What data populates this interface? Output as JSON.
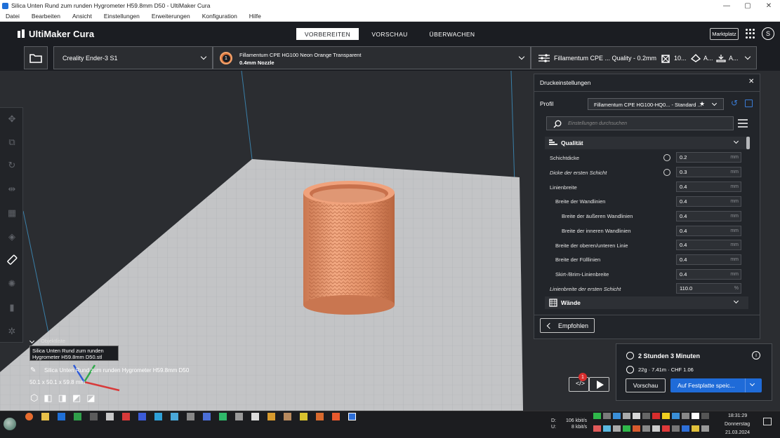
{
  "window": {
    "title": "Silica Unten Rund zum runden Hygrometer H59.8mm D50 - UltiMaker Cura"
  },
  "menu": [
    "Datei",
    "Bearbeiten",
    "Ansicht",
    "Einstellungen",
    "Erweiterungen",
    "Konfiguration",
    "Hilfe"
  ],
  "header": {
    "logo": "UltiMaker Cura",
    "tabs": [
      "VORBEREITEN",
      "VORSCHAU",
      "ÜBERWACHEN"
    ],
    "marketplace": "Marktplatz",
    "avatar_initial": "S"
  },
  "stagebar": {
    "printer": "Creality Ender-3 S1",
    "material_badge": "1",
    "material_name": "Fillamentum CPE HG100 Neon Orange Transparent",
    "nozzle": "0.4mm Nozzle",
    "profile_summary": "Fillamentum CPE ... Quality - 0.2mm",
    "infill": "10...",
    "support": "A...",
    "adhesion": "A..."
  },
  "object": {
    "list_label": "Objektliste",
    "tooltip_line1": "Silica Unten Rund zum runden",
    "tooltip_line2": "Hygrometer H59.8mm D50.stl",
    "name": "Silica Unten Rund zum runden Hygrometer H59.8mm D50",
    "dimensions": "50.1 x 50.1 x 59.8 mm"
  },
  "panel": {
    "title": "Druckeinstellungen",
    "profile_label": "Profil",
    "profile_value": "Fillamentum CPE HG100-HQ0... - Standard ...",
    "search_placeholder": "Einstellungen durchsuchen",
    "section_quality": "Qualität",
    "section_walls": "Wände",
    "rows": [
      {
        "label": "Schichtdicke",
        "value": "0.2",
        "unit": "mm"
      },
      {
        "label": "Dicke der ersten Schicht",
        "value": "0.3",
        "unit": "mm"
      },
      {
        "label": "Linienbreite",
        "value": "0.4",
        "unit": "mm"
      },
      {
        "label": "Breite der Wandlinien",
        "value": "0.4",
        "unit": "mm"
      },
      {
        "label": "Breite der äußeren Wandlinien",
        "value": "0.4",
        "unit": "mm"
      },
      {
        "label": "Breite der inneren Wandlinien",
        "value": "0.4",
        "unit": "mm"
      },
      {
        "label": "Breite der oberen/unteren Linie",
        "value": "0.4",
        "unit": "mm"
      },
      {
        "label": "Breite der Fülllinien",
        "value": "0.4",
        "unit": "mm"
      },
      {
        "label": "Skirt-/Brim-Linienbreite",
        "value": "0.4",
        "unit": "mm"
      },
      {
        "label": "Linienbreite der ersten Schicht",
        "value": "110.0",
        "unit": "%"
      }
    ],
    "recommended_button": "Empfohlen"
  },
  "print": {
    "time": "2 Stunden 3 Minuten",
    "material": "22g · 7.41m · CHF 1.06",
    "preview_button": "Vorschau",
    "save_button": "Auf Festplatte speic...",
    "notification_count": "1"
  },
  "taskbar": {
    "net_down_label": "D:",
    "net_down": "106 kbit/s",
    "net_up_label": "U:",
    "net_up": "8 kbit/s",
    "time": "18:31:29",
    "weekday": "Donnerstag",
    "date": "21.03.2024"
  }
}
